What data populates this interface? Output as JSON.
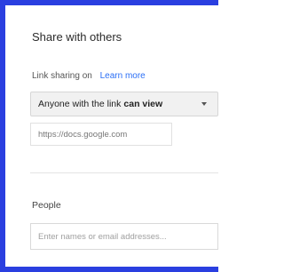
{
  "dialog": {
    "title": "Share with others"
  },
  "link_sharing": {
    "label": "Link sharing on",
    "learn_more": "Learn more",
    "access_prefix": "Anyone with the link",
    "access_level": "can view",
    "url": "https://docs.google.com"
  },
  "people": {
    "label": "People",
    "input_placeholder": "Enter names or email addresses..."
  },
  "colors": {
    "frame_border": "#2a3fe0",
    "link": "#2a6ef5"
  }
}
